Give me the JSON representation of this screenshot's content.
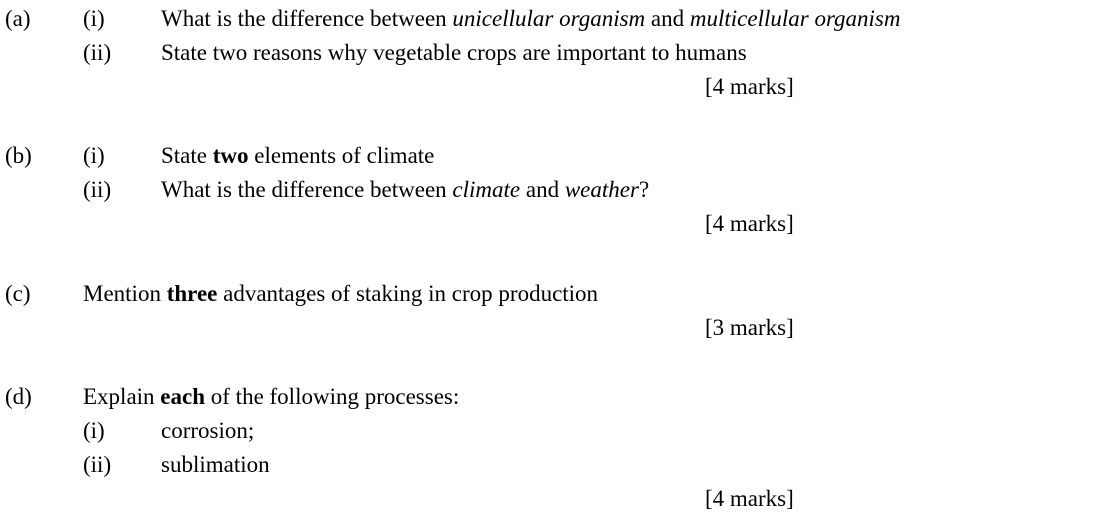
{
  "questions": {
    "a": {
      "label": "(a)",
      "parts": [
        {
          "label": "(i)",
          "segments": [
            "What is the difference between ",
            "unicellular organism",
            " and ",
            "multicellular organism"
          ]
        },
        {
          "label": "(ii)",
          "text": "State two reasons why vegetable crops are important to humans"
        }
      ],
      "marks": "[4 marks]"
    },
    "b": {
      "label": "(b)",
      "parts": [
        {
          "label": "(i)",
          "segments": [
            "State ",
            "two",
            " elements of climate"
          ]
        },
        {
          "label": "(ii)",
          "segments": [
            "What is the difference between ",
            "climate",
            " and ",
            "weather",
            "?"
          ]
        }
      ],
      "marks": "[4 marks]"
    },
    "c": {
      "label": "(c)",
      "segments": [
        "Mention ",
        "three",
        " advantages of staking in crop production"
      ],
      "marks": "[3 marks]"
    },
    "d": {
      "label": "(d)",
      "segments": [
        "Explain ",
        "each",
        " of the following processes:"
      ],
      "parts": [
        {
          "label": "(i)",
          "text": "corrosion;"
        },
        {
          "label": "(ii)",
          "text": "sublimation"
        }
      ],
      "marks": "[4 marks]"
    }
  }
}
